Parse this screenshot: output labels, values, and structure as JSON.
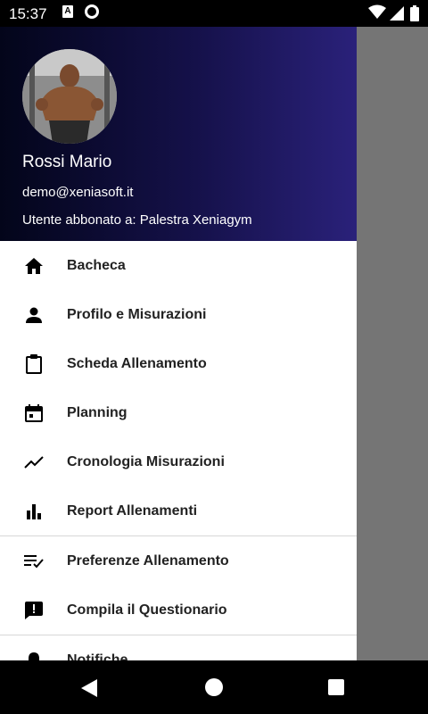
{
  "status_bar": {
    "time": "15:37",
    "a_icon_letter": "A"
  },
  "header": {
    "name": "Rossi Mario",
    "email": "demo@xeniasoft.it",
    "subscription": "Utente abbonato a: Palestra Xeniagym",
    "gradient": [
      "#03051a",
      "#2a217a"
    ]
  },
  "menu": {
    "group1": [
      {
        "label": "Bacheca",
        "icon": "home-icon"
      },
      {
        "label": "Profilo e Misurazioni",
        "icon": "person-icon"
      },
      {
        "label": "Scheda Allenamento",
        "icon": "clipboard-icon"
      },
      {
        "label": "Planning",
        "icon": "calendar-icon"
      },
      {
        "label": "Cronologia Misurazioni",
        "icon": "trend-icon"
      },
      {
        "label": "Report Allenamenti",
        "icon": "bar-chart-icon"
      }
    ],
    "group2": [
      {
        "label": "Preferenze Allenamento",
        "icon": "playlist-check-icon"
      },
      {
        "label": "Compila il Questionario",
        "icon": "feedback-icon"
      }
    ],
    "group3": [
      {
        "label": "Notifiche",
        "icon": "bell-icon"
      }
    ]
  }
}
